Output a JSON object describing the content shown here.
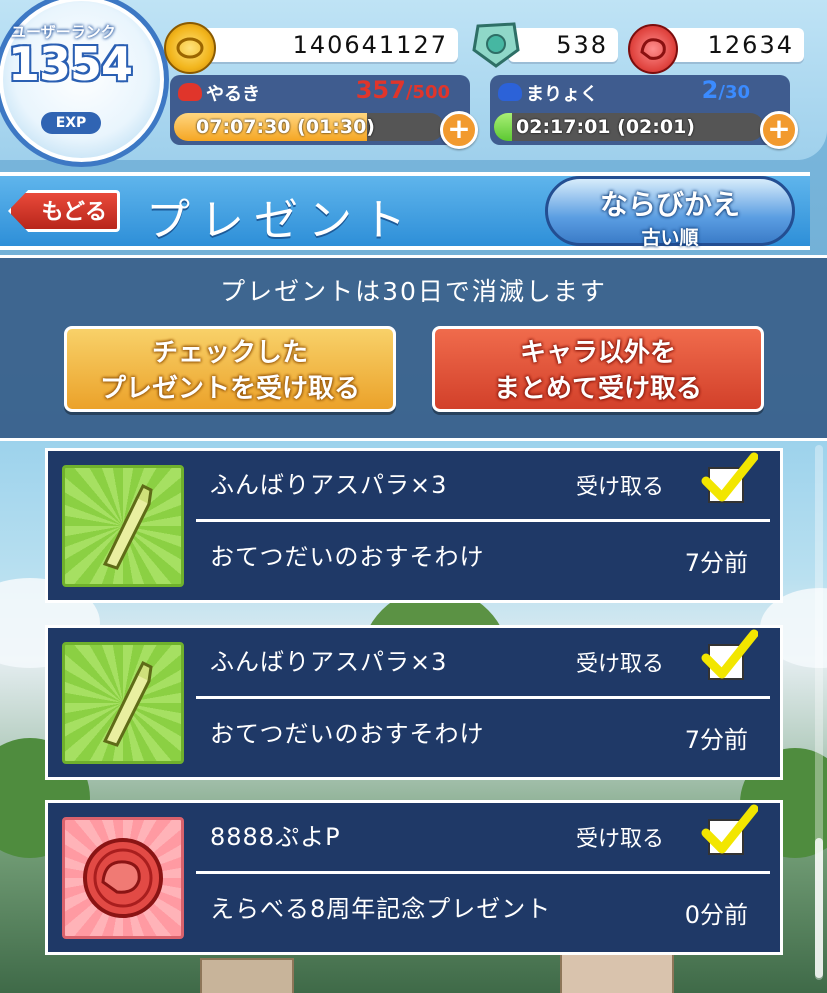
{
  "user": {
    "rank_label": "ユーザーランク",
    "rank": "1354",
    "exp_label": "EXP"
  },
  "currency": {
    "coins": "140641127",
    "gems": "538",
    "puyo_points": "12634"
  },
  "meters": {
    "yaruki": {
      "label": "やるき",
      "current": "357",
      "max": "/500",
      "timer": "07:07:30 (01:30)",
      "fill_fraction": 0.714
    },
    "maryoku": {
      "label": "まりょく",
      "current": "2",
      "max": "/30",
      "timer": "02:17:01 (02:01)",
      "fill_fraction": 0.067
    }
  },
  "header": {
    "back_label": "もどる",
    "title": "プレゼント",
    "sort_label": "ならびかえ",
    "sort_value": "古い順"
  },
  "notice": {
    "text": "プレゼントは30日で消滅します",
    "receive_checked_l1": "チェックした",
    "receive_checked_l2": "プレゼントを受け取る",
    "receive_all_l1": "キャラ以外を",
    "receive_all_l2": "まとめて受け取る"
  },
  "presents": [
    {
      "title": "ふんばりアスパラ×3",
      "receive": "受け取る",
      "sender": "おてつだいのおすそわけ",
      "ago": "7分前",
      "icon": "asparagus-icon",
      "checked": true
    },
    {
      "title": "ふんばりアスパラ×3",
      "receive": "受け取る",
      "sender": "おてつだいのおすそわけ",
      "ago": "7分前",
      "icon": "asparagus-icon",
      "checked": true
    },
    {
      "title": "8888ぷよP",
      "receive": "受け取る",
      "sender": "えらべる8周年記念プレゼント",
      "ago": "0分前",
      "icon": "puyo-point-coin-icon",
      "checked": true
    }
  ],
  "colors": {
    "accent_blue": "#2e8fd8",
    "panel_navy": "#1f3967",
    "check_yellow": "#f2e600",
    "yaruki_red": "#e0352b",
    "maryoku_blue": "#2c62d8"
  }
}
